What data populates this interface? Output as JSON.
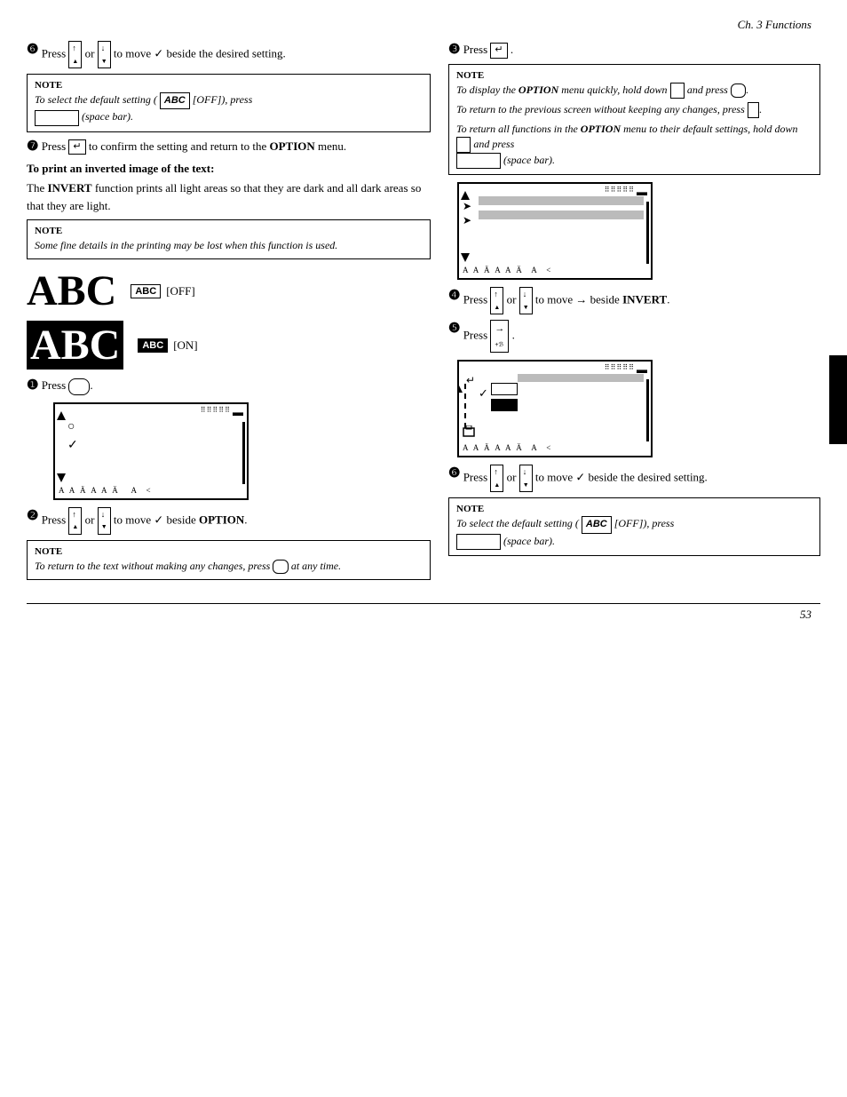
{
  "chapter": "Ch. 3 Functions",
  "page_number": "53",
  "left_col": {
    "step6": {
      "prefix": "Press",
      "middle": "or",
      "suffix": "to move ✓ beside the desired setting.",
      "num": "❻"
    },
    "note1": {
      "label": "NOTE",
      "text": "To select the default setting ( ABC  [OFF]), press",
      "text2": "(space bar)."
    },
    "step7": {
      "prefix": "Press",
      "suffix": "to confirm the setting and return to the",
      "bold": "OPTION",
      "suffix2": "menu.",
      "num": "❼"
    },
    "invert_title": "To print an inverted image of the text:",
    "invert_desc": "The INVERT function prints all light areas so that they are dark and all dark areas so that they are light.",
    "note2": {
      "label": "NOTE",
      "text": "Some fine details in the printing may be lost when this function is used."
    },
    "abc_off_label": "[OFF]",
    "abc_on_label": "[ON]",
    "step1": {
      "prefix": "Press",
      "num": "❶"
    },
    "step2": {
      "prefix": "Press",
      "or": "or",
      "suffix": "to move ✓ beside",
      "bold": "OPTION",
      "num": "❷"
    },
    "note3": {
      "label": "NOTE",
      "text": "To return to the text without making any changes, press",
      "text2": "at any time."
    }
  },
  "right_col": {
    "step3": {
      "prefix": "Press",
      "num": "❸"
    },
    "note4": {
      "label": "NOTE",
      "lines": [
        "To display the OPTION menu quickly, hold down  and press  .",
        "To return to the previous screen without keeping any changes, press  .",
        "To return all functions in the OPTION menu to their default settings, hold down  and press  (space bar)."
      ]
    },
    "step4": {
      "prefix": "Press",
      "or": "or",
      "suffix": "to move → beside",
      "bold": "INVERT",
      "num": "❹"
    },
    "step5": {
      "prefix": "Press",
      "num": "❺"
    },
    "step6b": {
      "prefix": "Press",
      "or": "or",
      "suffix": "to move ✓ beside the desired setting.",
      "num": "❻"
    },
    "note5": {
      "label": "NOTE",
      "text": "To select the default setting ( ABC  [OFF]), press",
      "text2": "(space bar)."
    }
  }
}
